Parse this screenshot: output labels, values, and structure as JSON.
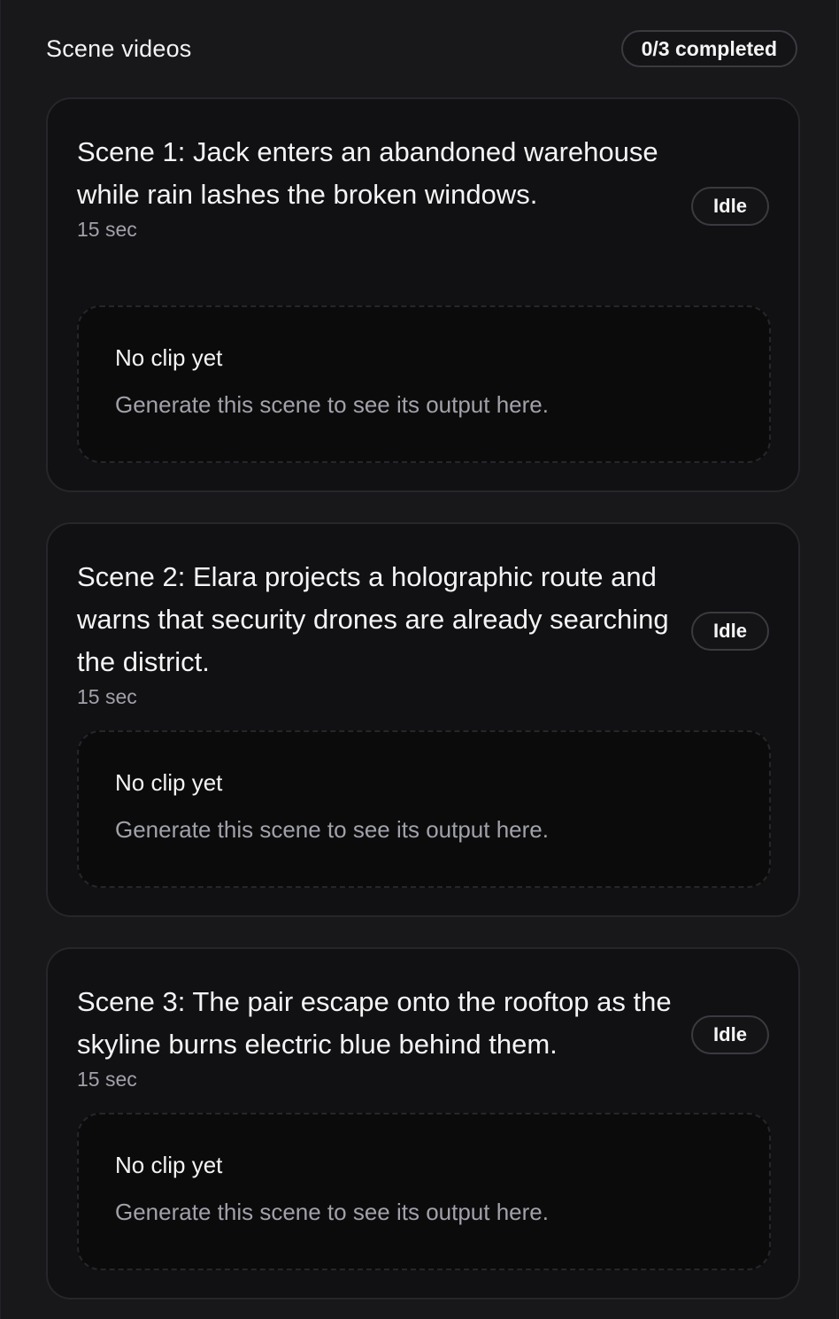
{
  "header": {
    "title": "Scene videos",
    "progress": "0/3 completed"
  },
  "scenes": [
    {
      "title": "Scene 1: Jack enters an abandoned warehouse while rain lashes the broken windows.",
      "duration": "15 sec",
      "status": "Idle",
      "clip_title": "No clip yet",
      "clip_desc": "Generate this scene to see its output here."
    },
    {
      "title": "Scene 2: Elara projects a holographic route and warns that security drones are already searching the district.",
      "duration": "15 sec",
      "status": "Idle",
      "clip_title": "No clip yet",
      "clip_desc": "Generate this scene to see its output here."
    },
    {
      "title": "Scene 3: The pair escape onto the rooftop as the skyline burns electric blue behind them.",
      "duration": "15 sec",
      "status": "Idle",
      "clip_title": "No clip yet",
      "clip_desc": "Generate this scene to see its output here."
    }
  ],
  "colors": {
    "background": "#18181b",
    "card": "#111113",
    "muted_text": "#a1a1aa",
    "text": "#f4f4f5"
  }
}
